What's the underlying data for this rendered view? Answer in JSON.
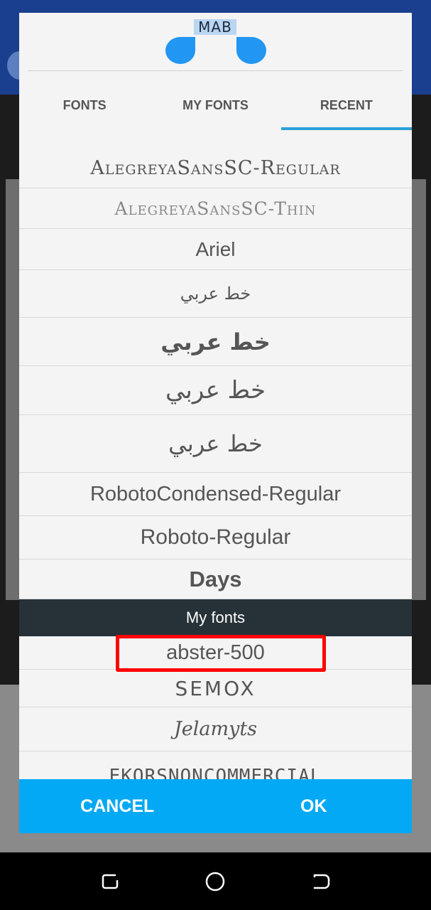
{
  "logo": {
    "text": "MAB"
  },
  "tabs": [
    {
      "label": "FONTS",
      "active": false
    },
    {
      "label": "MY FONTS",
      "active": false
    },
    {
      "label": "RECENT",
      "active": true
    }
  ],
  "fonts": [
    "AlegreyaSansSC-Regular",
    "AlegreyaSansSC-Thin",
    "Ariel",
    "خط عربي",
    "خط عربي",
    "خط عربي",
    "خط عربي",
    "RobotoCondensed-Regular",
    "Roboto-Regular",
    "Days"
  ],
  "my_fonts_header": "My fonts",
  "my_fonts": [
    "abster-500",
    "SEMOX",
    "Jelamyts",
    "EKORSNONCOMMERCIAL"
  ],
  "buttons": {
    "cancel": "CANCEL",
    "ok": "OK"
  },
  "colors": {
    "accent": "#03a9f4",
    "tab_indicator": "#2ba1d8",
    "section_header": "#263238",
    "highlight": "#ff0000"
  }
}
